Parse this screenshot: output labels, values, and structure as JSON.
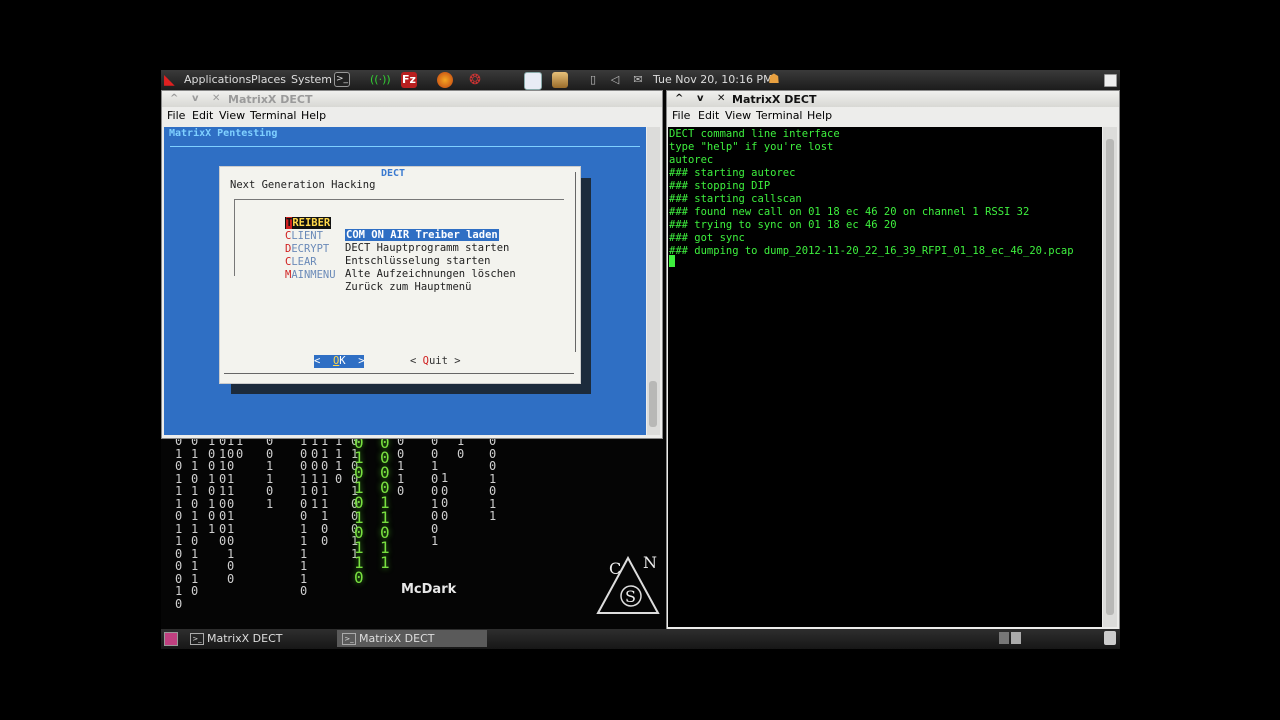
{
  "top_panel": {
    "applications": "Applications",
    "places": "Places",
    "system": "System",
    "datetime": "Tue Nov 20, 10:16 PM",
    "icons": [
      "terminal-icon",
      "network-icon",
      "filezilla-icon",
      "firefox-icon",
      "wireshark-icon",
      "text-editor-icon",
      "package-icon",
      "battery-icon",
      "volume-icon",
      "mail-icon",
      "user-icon"
    ]
  },
  "left_window": {
    "title": "MatrixX DECT",
    "menu": [
      "File",
      "Edit",
      "View",
      "Terminal",
      "Help"
    ],
    "header": "MatrixX Pentesting",
    "dialog": {
      "title": "DECT",
      "subtitle": "Next Generation Hacking",
      "items": [
        {
          "hot": "T",
          "rest": "REIBER",
          "desc": "COM ON AIR Treiber laden",
          "selected": true
        },
        {
          "hot": "C",
          "rest": "LIENT",
          "desc": "DECT Hauptprogramm starten",
          "selected": false
        },
        {
          "hot": "D",
          "rest": "ECRYPT",
          "desc": "Entschlüsselung starten",
          "selected": false
        },
        {
          "hot": "C",
          "rest": "LEAR",
          "desc": "Alte Aufzeichnungen löschen",
          "selected": false
        },
        {
          "hot": "M",
          "rest": "AINMENU",
          "desc": "Zurück zum Hauptmenü",
          "selected": false
        }
      ],
      "ok_left": "<  ",
      "ok_hot": "O",
      "ok_rest": "K  >",
      "quit_left": "< ",
      "quit_hot": "Q",
      "quit_rest": "uit >"
    }
  },
  "right_window": {
    "title": "MatrixX DECT",
    "menu": [
      "File",
      "Edit",
      "View",
      "Terminal",
      "Help"
    ],
    "lines": [
      "DECT command line interface",
      "type \"help\" if you're lost",
      "autorec",
      "### starting autorec",
      "### stopping DIP",
      "### starting callscan",
      "### found new call on 01 18 ec 46 20 on channel 1 RSSI 32",
      "### trying to sync on 01 18 ec 46 20",
      "### got sync",
      "### dumping to dump_2012-11-20_22_16_39_RFPI_01_18_ec_46_20.pcap"
    ]
  },
  "desktop": {
    "label": "McDark",
    "logo_letters": [
      "C",
      "N",
      "S"
    ]
  },
  "taskbar": {
    "tasks": [
      "MatrixX DECT",
      "MatrixX DECT"
    ]
  }
}
